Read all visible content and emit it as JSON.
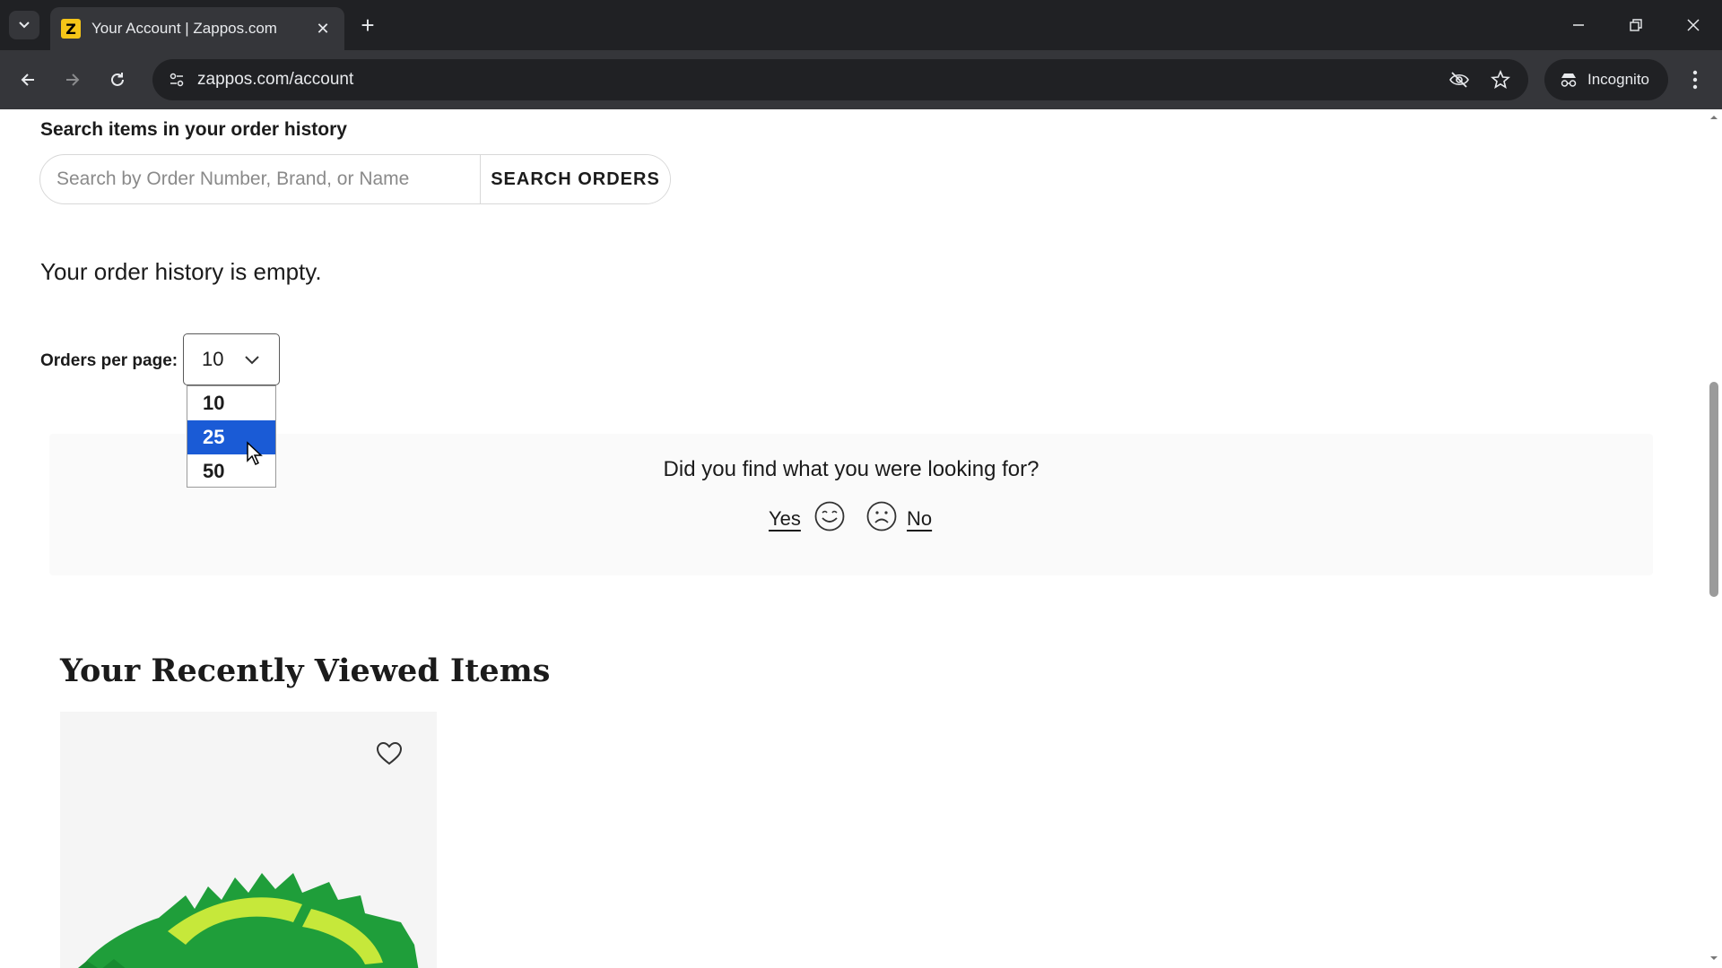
{
  "browser": {
    "tab_title": "Your Account | Zappos.com",
    "favicon_letter": "Z",
    "url": "zappos.com/account",
    "incognito_label": "Incognito"
  },
  "search": {
    "heading": "Search items in your order history",
    "placeholder": "Search by Order Number, Brand, or Name",
    "button_label": "SEARCH ORDERS"
  },
  "orders": {
    "empty_message": "Your order history is empty.",
    "per_page_label": "Orders per page:",
    "per_page_value": "10",
    "per_page_options": [
      "10",
      "25",
      "50"
    ],
    "highlighted_option": "25"
  },
  "feedback": {
    "question": "Did you find what you were looking for?",
    "yes_label": "Yes",
    "no_label": "No"
  },
  "recent": {
    "heading": "Your Recently Viewed Items"
  },
  "colors": {
    "option_highlight": "#1a5bd6",
    "product_green": "#1f9e3a",
    "product_lime": "#c6e83a"
  }
}
